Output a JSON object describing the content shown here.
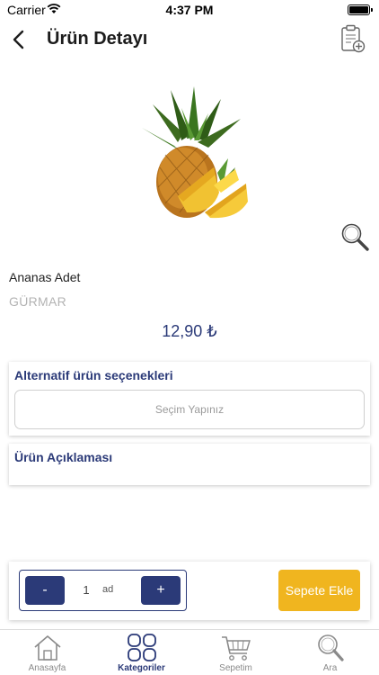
{
  "status_bar": {
    "carrier": "Carrier",
    "time": "4:37 PM"
  },
  "header": {
    "title": "Ürün Detayı"
  },
  "product": {
    "name": "Ananas Adet",
    "brand": "GÜRMAR",
    "price": "12,90 ₺"
  },
  "alternatives": {
    "title": "Alternatif ürün seçenekleri",
    "select_placeholder": "Seçim Yapınız"
  },
  "description": {
    "title": "Ürün Açıklaması"
  },
  "cart_panel": {
    "minus_label": "-",
    "quantity": "1",
    "unit": "ad",
    "plus_label": "+",
    "add_label": "Sepete Ekle"
  },
  "tabs": [
    {
      "label": "Anasayfa"
    },
    {
      "label": "Kategoriler"
    },
    {
      "label": "Sepetim"
    },
    {
      "label": "Ara"
    }
  ],
  "colors": {
    "accent": "#2b3a78",
    "add_button": "#f0b51f",
    "muted": "#b3b3b3"
  }
}
